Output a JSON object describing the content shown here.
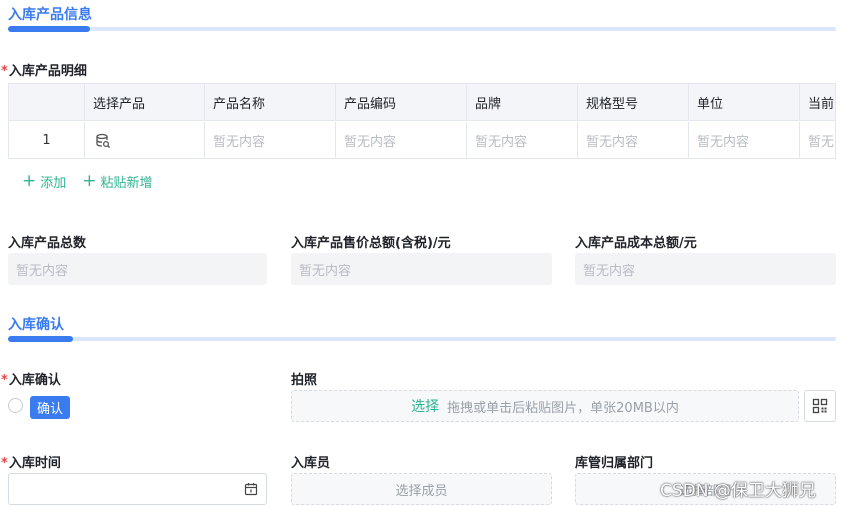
{
  "section_product": {
    "title": "入库产品信息"
  },
  "detail_label": {
    "required_mark": "*",
    "text": "入库产品明细"
  },
  "table": {
    "columns": [
      "",
      "选择产品",
      "产品名称",
      "产品编码",
      "品牌",
      "规格型号",
      "单位",
      "当前"
    ],
    "rows": [
      {
        "index": "1",
        "select_icon": "database-search-icon",
        "cells": [
          "暂无内容",
          "暂无内容",
          "暂无内容",
          "暂无内容",
          "暂无内容",
          "暂无"
        ]
      }
    ]
  },
  "actions": {
    "add_plus": "+",
    "add": "添加",
    "paste_plus": "+",
    "paste": "粘贴新增"
  },
  "summary": {
    "total_count_label": "入库产品总数",
    "total_count_value": "暂无内容",
    "sale_total_label": "入库产品售价总额(含税)/元",
    "sale_total_value": "暂无内容",
    "cost_total_label": "入库产品成本总额/元",
    "cost_total_value": "暂无内容"
  },
  "section_confirm": {
    "title": "入库确认"
  },
  "confirm": {
    "required_mark": "*",
    "label": "入库确认",
    "button": "确认",
    "photo_label": "拍照",
    "upload_link": "选择",
    "upload_hint": "拖拽或单击后粘贴图片，单张20MB以内"
  },
  "bottom": {
    "time_required_mark": "*",
    "time_label": "入库时间",
    "member_label": "入库员",
    "member_placeholder": "选择成员",
    "dept_label": "库管归属部门",
    "dept_placeholder": "选择部门"
  },
  "watermark": "CSDN @保卫大狮兄",
  "colors": {
    "accent": "#3a7cf0",
    "link_green": "#2fb394",
    "required_red": "#e5484d"
  }
}
